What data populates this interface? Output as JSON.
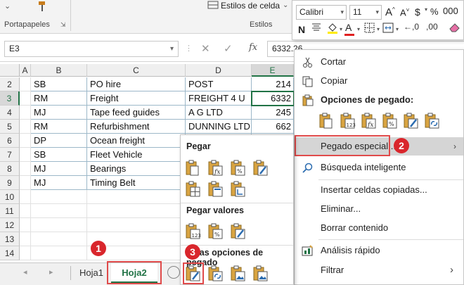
{
  "ribbon": {
    "styles_btn": "Estilos de celda",
    "group_clipboard": "Portapapeles",
    "group_styles": "Estilos"
  },
  "formula_bar": {
    "name_box": "E3",
    "value": "6332.26",
    "fx": "fx"
  },
  "grid": {
    "columns": [
      "A",
      "B",
      "C",
      "D",
      "E"
    ],
    "rows": [
      {
        "n": "2",
        "b": "SB",
        "c": "PO hire",
        "d": "POST",
        "e": "214"
      },
      {
        "n": "3",
        "b": "RM",
        "c": "Freight",
        "d": "FREIGHT 4 U",
        "e": "6332"
      },
      {
        "n": "4",
        "b": "MJ",
        "c": "Tape feed guides",
        "d": "A G LTD",
        "e": "245"
      },
      {
        "n": "5",
        "b": "RM",
        "c": "Refurbishment",
        "d": "DUNNING LTD",
        "e": "662"
      },
      {
        "n": "6",
        "b": "DP",
        "c": "Ocean freight",
        "d": "",
        "e": ""
      },
      {
        "n": "7",
        "b": "SB",
        "c": "Fleet Vehicle",
        "d": "",
        "e": ""
      },
      {
        "n": "8",
        "b": "MJ",
        "c": "Bearings",
        "d": "",
        "e": ""
      },
      {
        "n": "9",
        "b": "MJ",
        "c": "Timing Belt",
        "d": "",
        "e": ""
      },
      {
        "n": "10",
        "b": "",
        "c": "",
        "d": "",
        "e": ""
      },
      {
        "n": "11",
        "b": "",
        "c": "",
        "d": "",
        "e": ""
      },
      {
        "n": "12",
        "b": "",
        "c": "",
        "d": "",
        "e": ""
      },
      {
        "n": "13",
        "b": "",
        "c": "",
        "d": "",
        "e": ""
      },
      {
        "n": "14",
        "b": "",
        "c": "",
        "d": "",
        "e": ""
      }
    ]
  },
  "sheets": {
    "tab1": "Hoja1",
    "tab2": "Hoja2"
  },
  "mini_toolbar": {
    "font": "Calibri",
    "size": "11",
    "bold": "N",
    "font_color_letter": "A"
  },
  "context_menu": {
    "cut": "Cortar",
    "copy": "Copiar",
    "paste_options": "Opciones de pegado:",
    "paste_special": "Pegado especial...",
    "smart_lookup": "Búsqueda inteligente",
    "insert_copied": "Insertar celdas copiadas...",
    "delete": "Eliminar...",
    "clear": "Borrar contenido",
    "quick_analysis": "Análisis rápido",
    "filter": "Filtrar"
  },
  "submenu": {
    "paste": "Pegar",
    "paste_values": "Pegar valores",
    "other_options": "Otras opciones de pegado"
  },
  "badges": [
    "1",
    "2",
    "3"
  ],
  "colors": {
    "excel_green": "#217346",
    "badge_red": "#d9262c",
    "highlight": "#e04a4a"
  }
}
